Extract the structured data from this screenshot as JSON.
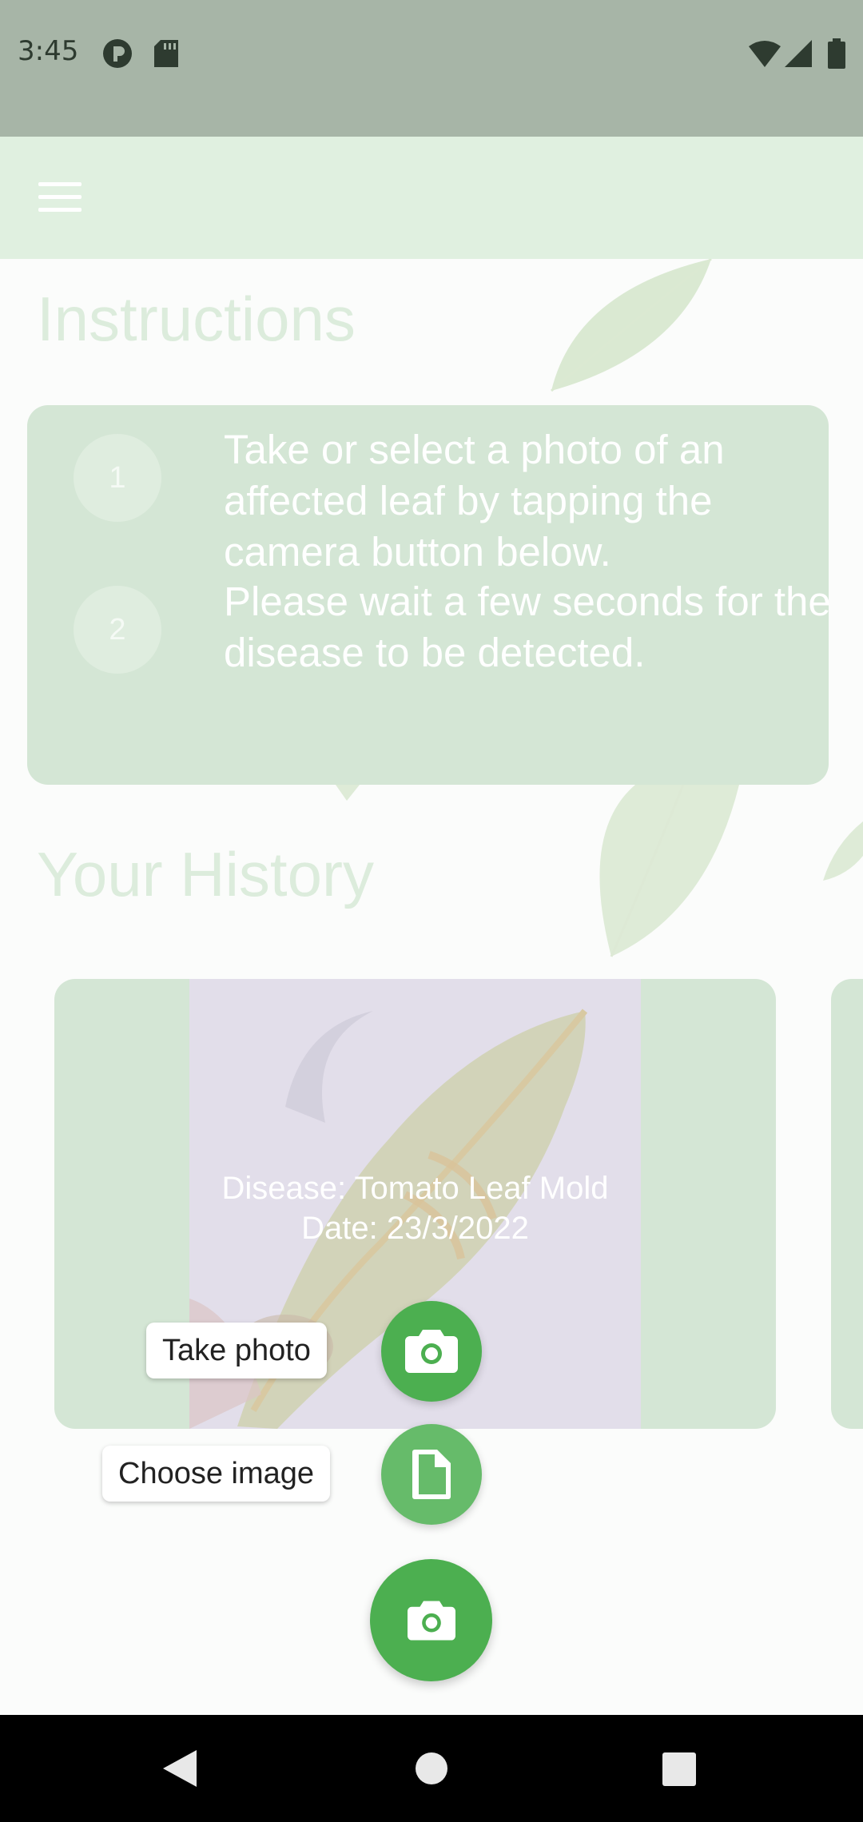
{
  "status_bar": {
    "time": "3:45"
  },
  "instructions": {
    "title": "Instructions",
    "steps": [
      {
        "number": "1",
        "text": "Take or select a photo of an affected leaf by tapping the camera button below."
      },
      {
        "number": "2",
        "text": "Please wait a few seconds for the disease to be detected."
      }
    ]
  },
  "history": {
    "title": "Your History",
    "items": [
      {
        "disease": "Disease: Tomato Leaf Mold",
        "date": "Date: 23/3/2022"
      }
    ]
  },
  "fab_menu": {
    "take_photo_label": "Take photo",
    "choose_image_label": "Choose image"
  },
  "icons": {
    "menu": "hamburger-menu-icon",
    "camera": "camera-icon",
    "file": "file-icon",
    "back": "back-icon",
    "home": "home-icon",
    "recents": "recents-icon"
  },
  "colors": {
    "fab_primary": "#4caf50",
    "fab_secondary": "#66bb6a",
    "card": "#d4e6d5",
    "app_bar": "#e0f0e0"
  }
}
